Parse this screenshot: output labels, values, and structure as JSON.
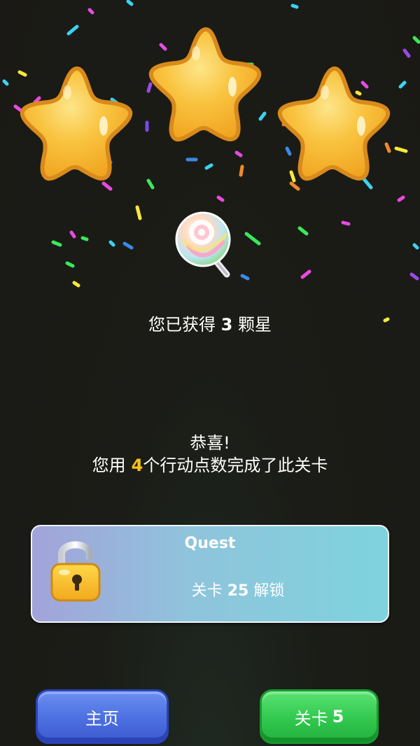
{
  "stars_earned_text": {
    "prefix": "您已获得",
    "count": "3",
    "suffix": "颗星"
  },
  "congrats": {
    "title": "恭喜!",
    "line_prefix": "您用",
    "moves": "4",
    "line_suffix": "个行动点数完成了此关卡"
  },
  "quest": {
    "title": "Quest",
    "unlock_prefix": "关卡",
    "unlock_level": "25",
    "unlock_suffix": "解锁"
  },
  "buttons": {
    "home_label": "主页",
    "next_label": "关卡",
    "next_level": "5"
  },
  "icons": [
    "star-icon",
    "lollipop-icon",
    "padlock-icon"
  ],
  "stars_filled": 3,
  "colors": {
    "star": "#f9c440",
    "moves_highlight": "#f7c21a",
    "home_button": "#4b6fe0",
    "next_button": "#31c84f"
  }
}
